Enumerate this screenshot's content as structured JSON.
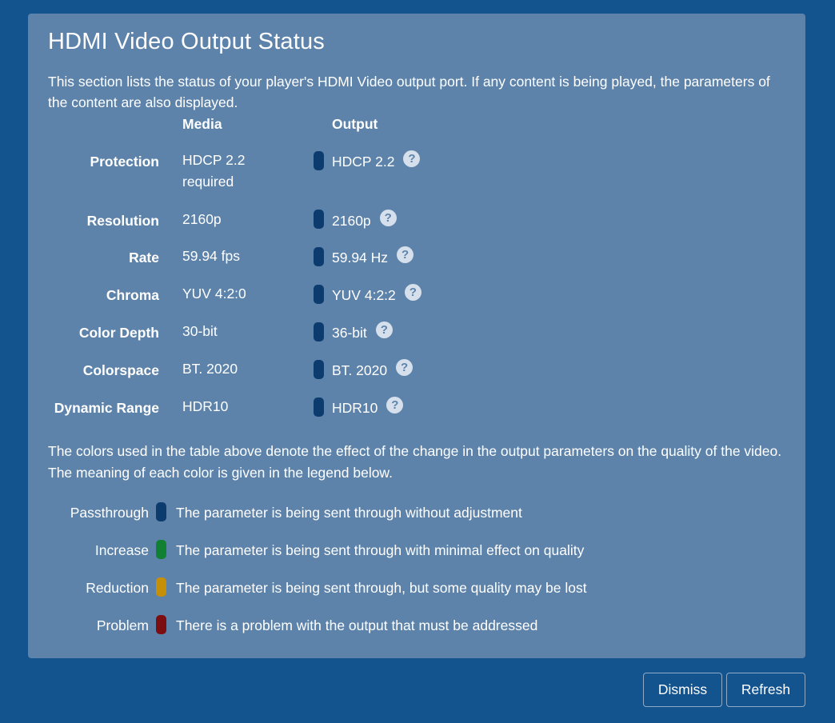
{
  "panel": {
    "title": "HDMI Video Output Status",
    "intro": "This section lists the status of your player's HDMI Video output port. If any content is being played, the parameters of the content are also displayed."
  },
  "table": {
    "media_header": "Media",
    "output_header": "Output",
    "rows": [
      {
        "label": "Protection",
        "media": "HDCP 2.2 required",
        "output": "HDCP 2.2",
        "status": "passthrough"
      },
      {
        "label": "Resolution",
        "media": "2160p",
        "output": "2160p",
        "status": "passthrough"
      },
      {
        "label": "Rate",
        "media": "59.94 fps",
        "output": "59.94 Hz",
        "status": "passthrough"
      },
      {
        "label": "Chroma",
        "media": "YUV 4:2:0",
        "output": "YUV 4:2:2",
        "status": "passthrough"
      },
      {
        "label": "Color Depth",
        "media": "30-bit",
        "output": "36-bit",
        "status": "passthrough"
      },
      {
        "label": "Colorspace",
        "media": "BT. 2020",
        "output": "BT. 2020",
        "status": "passthrough"
      },
      {
        "label": "Dynamic Range",
        "media": "HDR10",
        "output": "HDR10",
        "status": "passthrough"
      }
    ],
    "help_glyph": "?"
  },
  "legend": {
    "intro": "The colors used in the table above denote the effect of the change in the output parameters on the quality of the video. The meaning of each color is given in the legend below.",
    "items": [
      {
        "label": "Passthrough",
        "description": "The parameter is being sent through without adjustment",
        "color": "#0c3c6e"
      },
      {
        "label": "Increase",
        "description": "The parameter is being sent through with minimal effect on quality",
        "color": "#118032"
      },
      {
        "label": "Reduction",
        "description": "The parameter is being sent through, but some quality may be lost",
        "color": "#c58f08"
      },
      {
        "label": "Problem",
        "description": "There is a problem with the output that must be addressed",
        "color": "#7a0e10"
      }
    ]
  },
  "buttons": {
    "dismiss": "Dismiss",
    "refresh": "Refresh"
  },
  "colors": {
    "background": "#13538e",
    "panel": "#5d83aa"
  }
}
